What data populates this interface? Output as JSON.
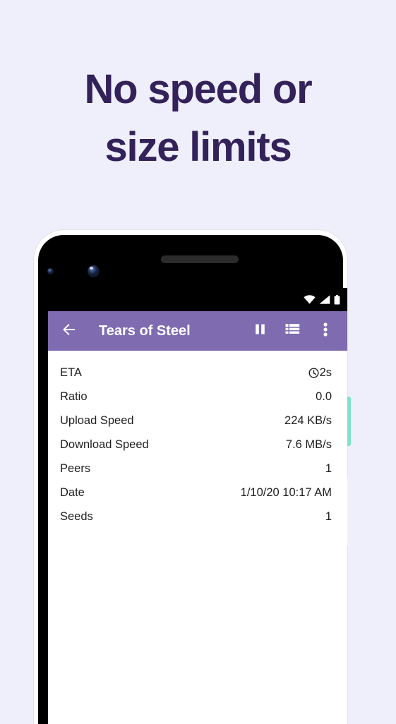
{
  "headline": {
    "line1": "No speed or",
    "line2": "size limits",
    "color": "#332259"
  },
  "theme": {
    "background": "#efeefb",
    "appbar_purple": "#7e6bb0",
    "power_button": "#7fe3c8",
    "volume_button": "#f2f2f2"
  },
  "phone": {
    "status_bar": {
      "icons": [
        "wifi-icon",
        "cellular-signal-icon",
        "battery-icon"
      ]
    },
    "app_bar": {
      "back_icon": "arrow-left-icon",
      "title": "Tears of Steel",
      "actions": [
        {
          "icon": "pause-icon",
          "name": "pause-button"
        },
        {
          "icon": "list-icon",
          "name": "file-list-button"
        },
        {
          "icon": "more-vertical-icon",
          "name": "overflow-menu-button"
        }
      ]
    },
    "details": [
      {
        "label": "ETA",
        "value": "2s",
        "icon": "clock-icon"
      },
      {
        "label": "Ratio",
        "value": "0.0",
        "icon": ""
      },
      {
        "label": "Upload Speed",
        "value": "224 KB/s",
        "icon": ""
      },
      {
        "label": "Download Speed",
        "value": "7.6 MB/s",
        "icon": ""
      },
      {
        "label": "Peers",
        "value": "1",
        "icon": ""
      },
      {
        "label": "Date",
        "value": "1/10/20 10:17 AM",
        "icon": ""
      },
      {
        "label": "Seeds",
        "value": "1",
        "icon": ""
      }
    ]
  }
}
